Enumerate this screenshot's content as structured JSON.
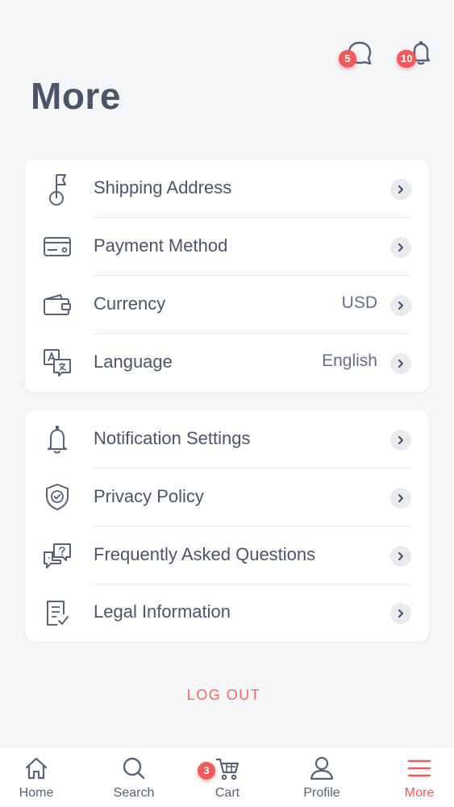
{
  "header": {
    "title": "More",
    "chat_badge": "5",
    "bell_badge": "10"
  },
  "groups": [
    {
      "items": [
        {
          "label": "Shipping Address",
          "value": "",
          "icon": "flag-pin-icon"
        },
        {
          "label": "Payment Method",
          "value": "",
          "icon": "credit-card-icon"
        },
        {
          "label": "Currency",
          "value": "USD",
          "icon": "wallet-icon"
        },
        {
          "label": "Language",
          "value": "English",
          "icon": "translate-icon"
        }
      ]
    },
    {
      "items": [
        {
          "label": "Notification Settings",
          "value": "",
          "icon": "bell-icon"
        },
        {
          "label": "Privacy Policy",
          "value": "",
          "icon": "shield-check-icon"
        },
        {
          "label": "Frequently Asked Questions",
          "value": "",
          "icon": "faq-chat-icon"
        },
        {
          "label": "Legal Information",
          "value": "",
          "icon": "document-check-icon"
        }
      ]
    }
  ],
  "logout_label": "LOG OUT",
  "tabbar": {
    "items": [
      {
        "label": "Home",
        "icon": "home-icon"
      },
      {
        "label": "Search",
        "icon": "search-icon"
      },
      {
        "label": "Cart",
        "icon": "cart-icon",
        "badge": "3"
      },
      {
        "label": "Profile",
        "icon": "profile-icon"
      },
      {
        "label": "More",
        "icon": "menu-icon",
        "active": true
      }
    ]
  },
  "colors": {
    "accent": "#f25a5a",
    "text": "#4b5568",
    "background": "#f5f6f8"
  }
}
